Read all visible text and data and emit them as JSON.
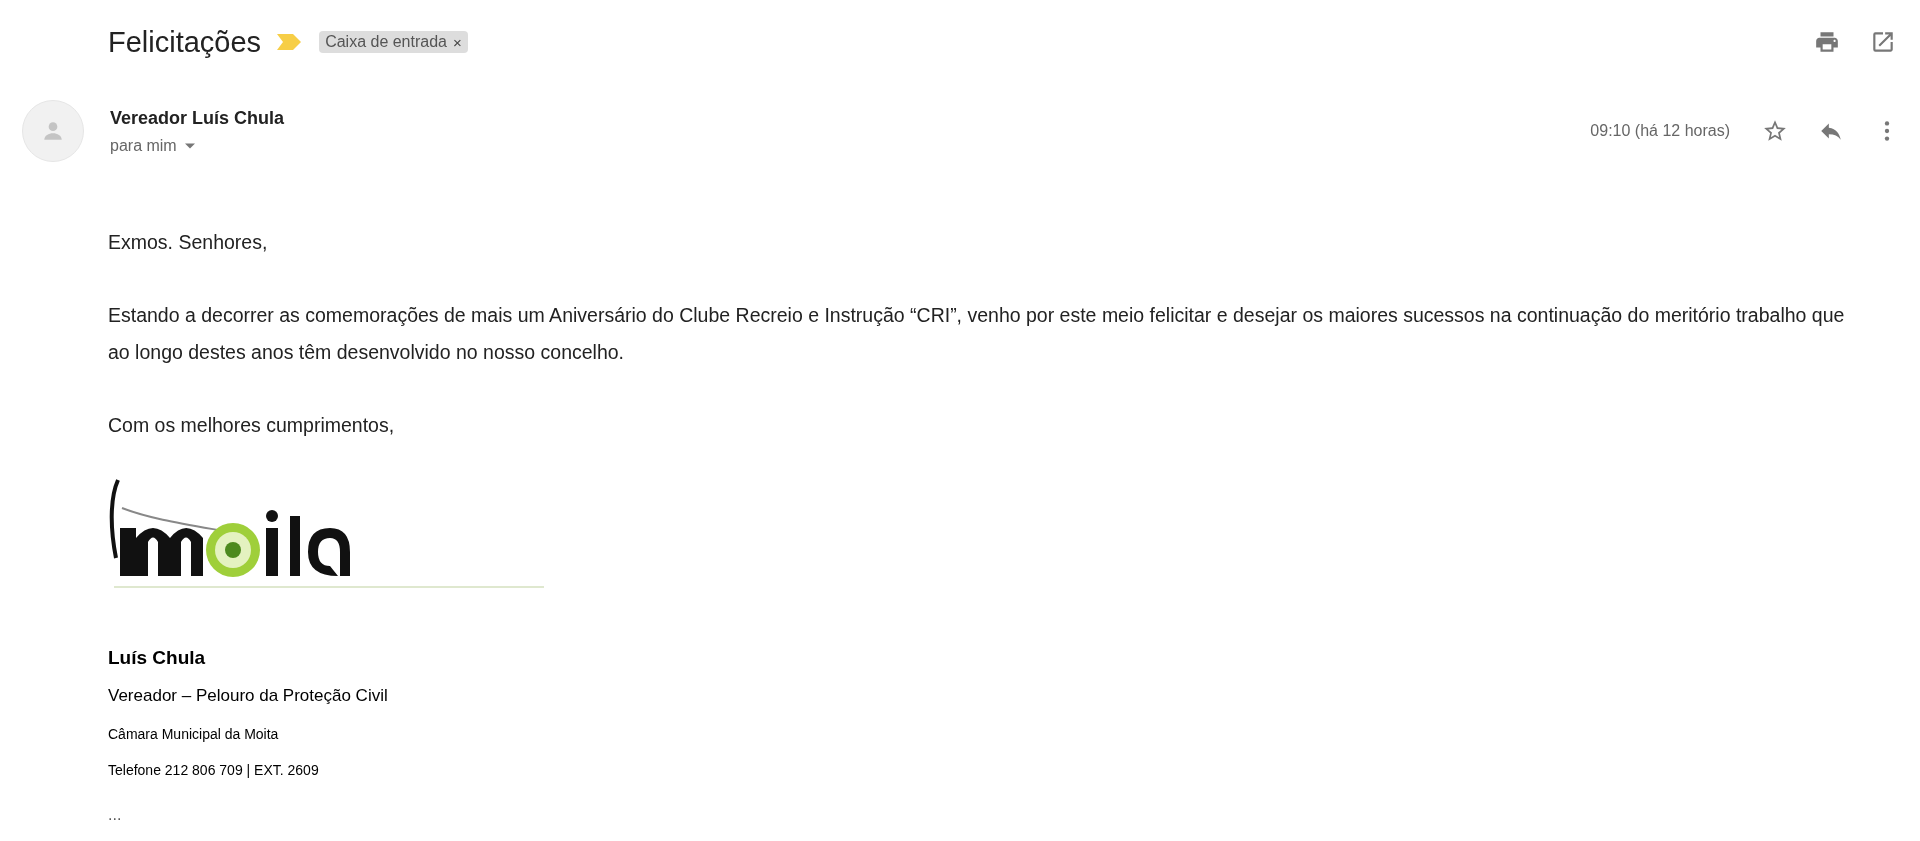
{
  "subject": "Felicitações",
  "important": true,
  "labels": [
    {
      "text": "Caixa de entrada",
      "remove": "×"
    }
  ],
  "sender": {
    "name": "Vereador Luís Chula",
    "recipient": "para mim"
  },
  "time": "09:10 (há 12 horas)",
  "starred": false,
  "body": [
    "Exmos. Senhores,",
    "Estando a decorrer as comemorações de mais um Aniversário do Clube Recreio e Instrução “CRI”, venho por este meio felicitar e desejar os maiores sucessos na continuação do meritório trabalho que ao longo destes anos têm desenvolvido no nosso concelho.",
    "Com os melhores cumprimentos,"
  ],
  "signature": {
    "name": "Luís Chula",
    "role": "Vereador – Pelouro da Proteção Civil",
    "org": "Câmara Municipal da Moita",
    "phone": "Telefone 212 806 709 | EXT. 2609"
  },
  "trimmed": "..."
}
